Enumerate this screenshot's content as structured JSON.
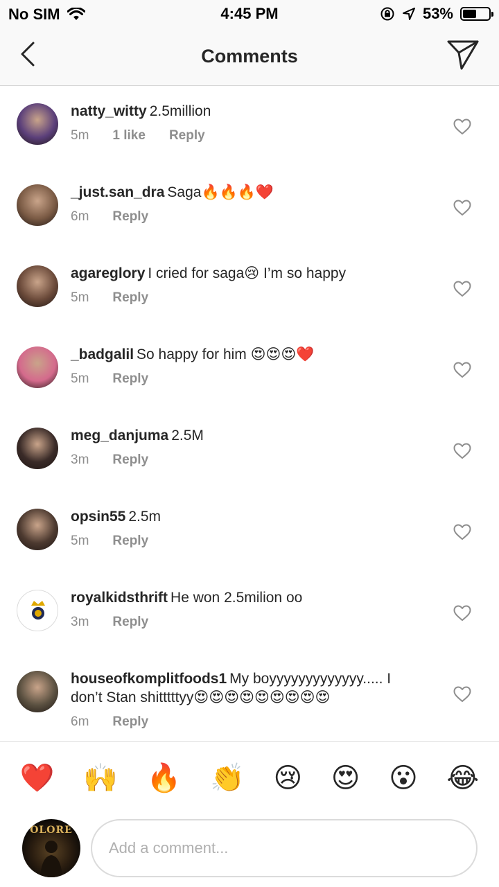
{
  "status_bar": {
    "carrier": "No SIM",
    "time": "4:45 PM",
    "battery": "53%",
    "battery_level": 0.53
  },
  "header": {
    "title": "Comments"
  },
  "comments": [
    {
      "username": "natty_witty",
      "text": "2.5million",
      "time": "5m",
      "likes": "1 like",
      "reply": "Reply",
      "avatar_color": "#5b3f7a"
    },
    {
      "username": "_just.san_dra",
      "text": "Saga🔥🔥🔥❤️",
      "time": "6m",
      "likes": "",
      "reply": "Reply",
      "avatar_color": "#7a5a44"
    },
    {
      "username": "agareglory",
      "text": "I cried for saga😢 I’m so happy",
      "time": "5m",
      "likes": "",
      "reply": "Reply",
      "avatar_color": "#6b4a3a"
    },
    {
      "username": "_badgalil",
      "text": "So happy for him 😍😍😍❤️",
      "time": "5m",
      "likes": "",
      "reply": "Reply",
      "avatar_color": "#d46a8c"
    },
    {
      "username": "meg_danjuma",
      "text": "2.5M",
      "time": "3m",
      "likes": "",
      "reply": "Reply",
      "avatar_color": "#3a2b28"
    },
    {
      "username": "opsin55",
      "text": "2.5m",
      "time": "5m",
      "likes": "",
      "reply": "Reply",
      "avatar_color": "#4d3a30"
    },
    {
      "username": "royalkidsthrift",
      "text": "He won 2.5milion oo",
      "time": "3m",
      "likes": "",
      "reply": "Reply",
      "avatar_color": "#ffffff"
    },
    {
      "username": "houseofkomplitfoods1",
      "text": "My boyyyyyyyyyyyyy..... I don’t Stan shitttttyy😍😍😍😍😍😍😍😍😍",
      "time": "6m",
      "likes": "",
      "reply": "Reply",
      "avatar_color": "#5a5040"
    }
  ],
  "emoji_bar": [
    "❤️",
    "🙌",
    "🔥",
    "👏",
    "😢",
    "😍",
    "😮",
    "😂"
  ],
  "composer": {
    "placeholder": "Add a comment...",
    "avatar_label": "OLORE"
  }
}
